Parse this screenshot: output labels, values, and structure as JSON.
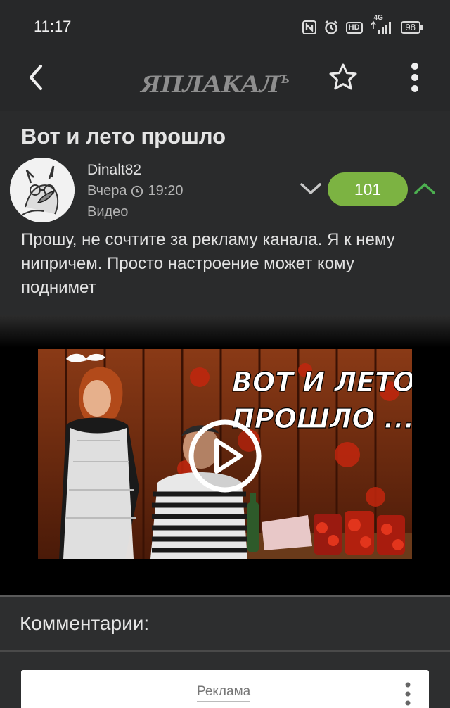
{
  "status_bar": {
    "time": "11:17",
    "network": "4G",
    "hd": "HD",
    "battery": "98"
  },
  "header": {
    "logo_text": "ЯПЛАКАЛ",
    "logo_suffix": "Ъ"
  },
  "post": {
    "title": "Вот и лето прошло",
    "author": "Dinalt82",
    "date": "Вчера",
    "time": "19:20",
    "category": "Видео",
    "rating": "101",
    "text": "Прошу, не сочтите за рекламу канала. Я к нему нипричем. Просто настроение может кому поднимет"
  },
  "video": {
    "overlay_line1": "ВОТ И ЛЕТО",
    "overlay_line2": "ПРОШЛО ..."
  },
  "comments": {
    "title": "Комментарии:",
    "ad_label": "Реклама"
  },
  "colors": {
    "background": "#272829",
    "rating_green": "#7cb342",
    "upvote_green": "#4caf50"
  }
}
